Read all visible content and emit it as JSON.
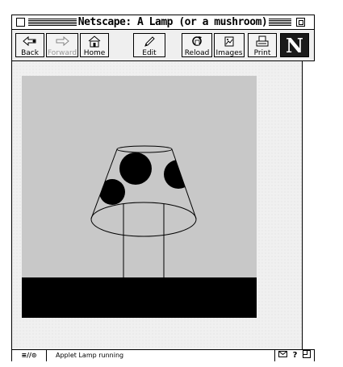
{
  "window": {
    "title": "Netscape: A Lamp (or a mushroom)"
  },
  "toolbar": {
    "buttons": [
      {
        "label": "Back",
        "icon": "back-arrow-icon",
        "enabled": true
      },
      {
        "label": "Forward",
        "icon": "forward-arrow-icon",
        "enabled": false
      },
      {
        "label": "Home",
        "icon": "home-icon",
        "enabled": true
      },
      {
        "label": "Edit",
        "icon": "pencil-icon",
        "enabled": true
      },
      {
        "label": "Reload",
        "icon": "reload-icon",
        "enabled": true
      },
      {
        "label": "Images",
        "icon": "images-icon",
        "enabled": true
      },
      {
        "label": "Print",
        "icon": "printer-icon",
        "enabled": true
      }
    ],
    "logo_letter": "N"
  },
  "applet": {
    "name": "Lamp",
    "background_color": "#c8c8c8",
    "floor_color": "#000000"
  },
  "status": {
    "left_indicator": "≡//⊙",
    "message": "Applet Lamp running"
  },
  "colors": {
    "window_border": "#000000",
    "page_background": "#f0f0f0"
  }
}
